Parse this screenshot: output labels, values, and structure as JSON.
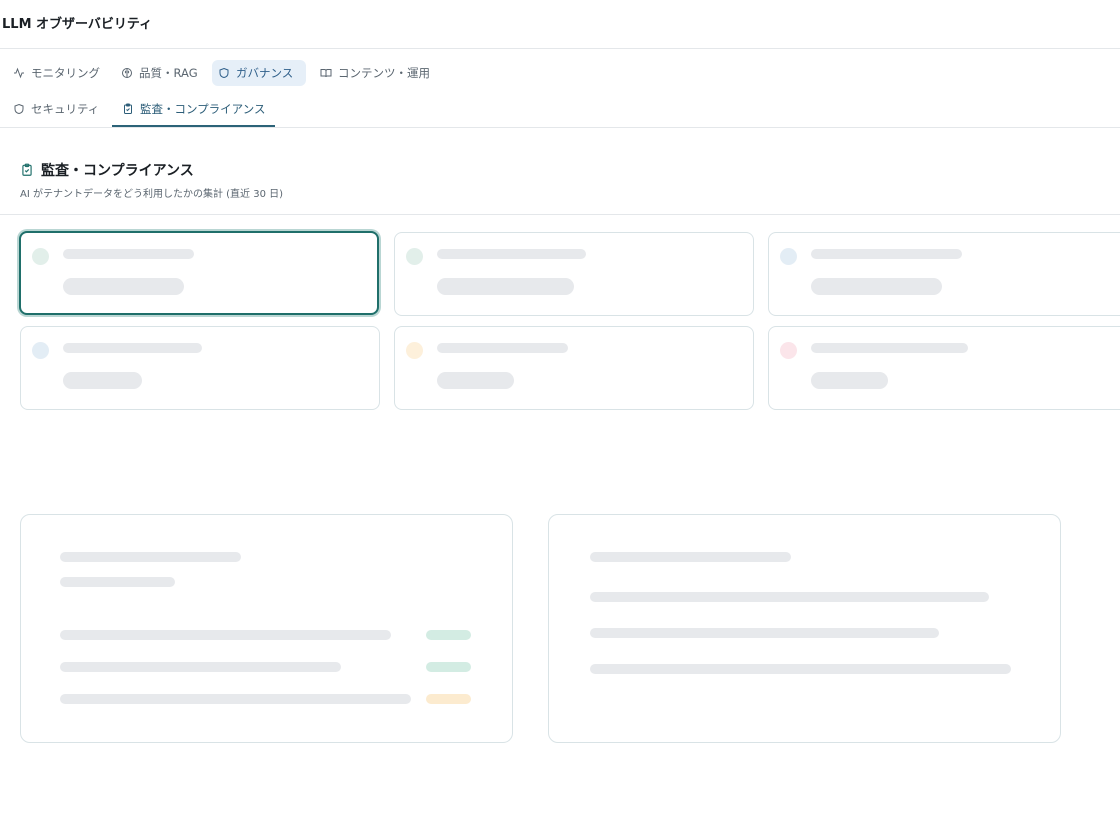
{
  "app": {
    "title": "LLM オブザーバビリティ"
  },
  "tabs": [
    {
      "label": "モニタリング",
      "icon": "activity-icon"
    },
    {
      "label": "品質・RAG",
      "icon": "brain-icon"
    },
    {
      "label": "ガバナンス",
      "icon": "shield-icon",
      "selected": true
    },
    {
      "label": "コンテンツ・運用",
      "icon": "book-icon"
    }
  ],
  "subtabs": [
    {
      "label": "セキュリティ",
      "icon": "shield-icon"
    },
    {
      "label": "監査・コンプライアンス",
      "icon": "clipboard-check-icon",
      "active": true
    }
  ],
  "section": {
    "title": "監査・コンプライアンス",
    "subtitle": "AI がテナントデータをどう利用したかの集計 (直近 30 日)",
    "icon": "clipboard-check-icon"
  },
  "colors": {
    "accent": "#2c6378",
    "focus_border": "#1f6f6a",
    "skeleton": "#e7e9ec",
    "dot_green": "#e2efea",
    "dot_blue": "#e3edf5",
    "dot_amber": "#fdf0db",
    "dot_pink": "#fbe5ea",
    "tag_green": "#d3ece3",
    "tag_amber": "#fcebcf"
  },
  "state": {
    "loading": true
  }
}
